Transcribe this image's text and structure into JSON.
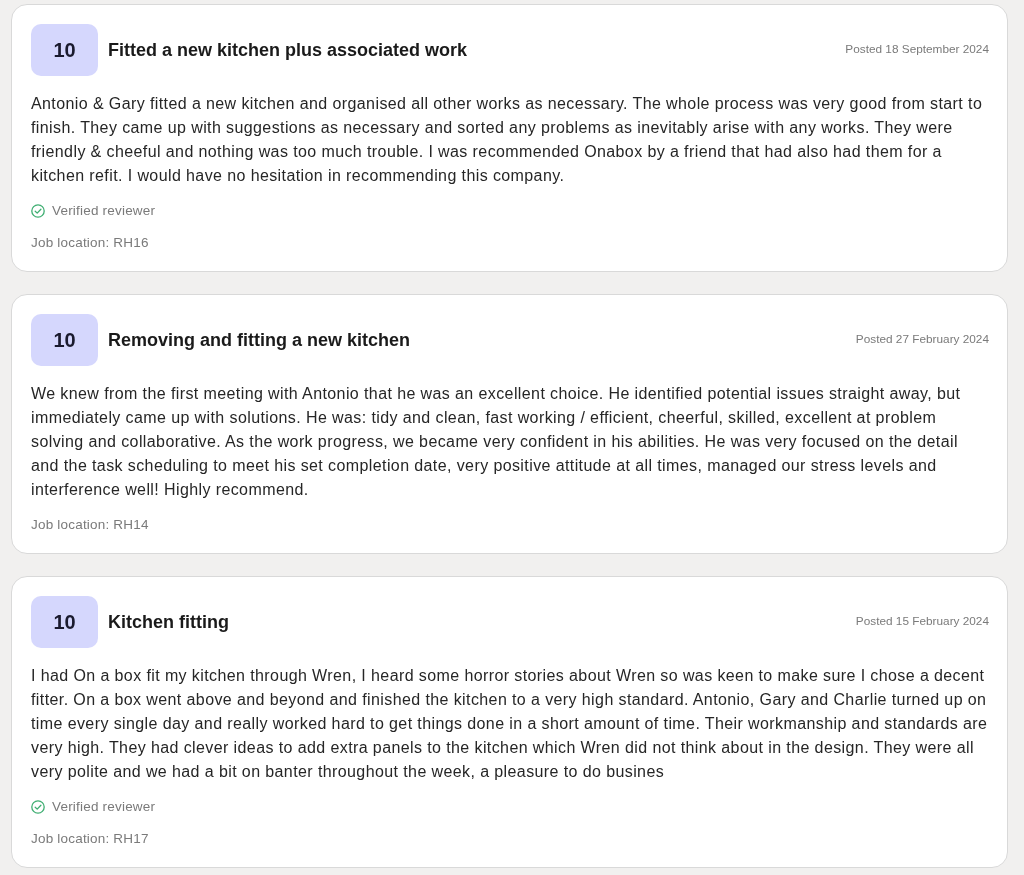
{
  "reviews": [
    {
      "score": "10",
      "title": "Fitted a new kitchen plus associated work",
      "posted": "Posted 18 September 2024",
      "body": "Antonio & Gary fitted a new kitchen and organised all other works as necessary. The whole process was very good from start to finish. They came up with suggestions as necessary and sorted any problems as inevitably arise with any works. They were friendly & cheeful and nothing was too much trouble. I was recommended Onabox by a friend that had also had them for a kitchen refit. I would have no hesitation in recommending this company.",
      "verified": true,
      "verified_label": "Verified reviewer",
      "job_location": "Job location: RH16"
    },
    {
      "score": "10",
      "title": "Removing and fitting a new kitchen",
      "posted": "Posted 27 February 2024",
      "body": "We knew from the first meeting with Antonio that he was an excellent choice. He identified potential issues straight away, but immediately came up with solutions. He was: tidy and clean, fast working / efficient, cheerful, skilled, excellent at problem solving and collaborative. As the work progress, we became very confident in his abilities. He was very focused on the detail and the task scheduling to meet his set completion date, very positive attitude at all times, managed our stress levels and interference well! Highly recommend.",
      "verified": false,
      "job_location": "Job location: RH14"
    },
    {
      "score": "10",
      "title": "Kitchen fitting",
      "posted": "Posted 15 February 2024",
      "body": "I had On a box fit my kitchen through Wren, I heard some horror stories about Wren so was keen to make sure I chose a decent fitter. On a box went above and beyond and finished the kitchen to a very high standard. Antonio, Gary and Charlie turned up on time every single day and really worked hard to get things done in a short amount of time. Their workmanship and standards are very high. They had clever ideas to add extra panels to the kitchen which Wren did not think about in the design. They were all very polite and we had a bit on banter throughout the week, a pleasure to do busines",
      "verified": true,
      "verified_label": "Verified reviewer",
      "job_location": "Job location: RH17"
    }
  ]
}
